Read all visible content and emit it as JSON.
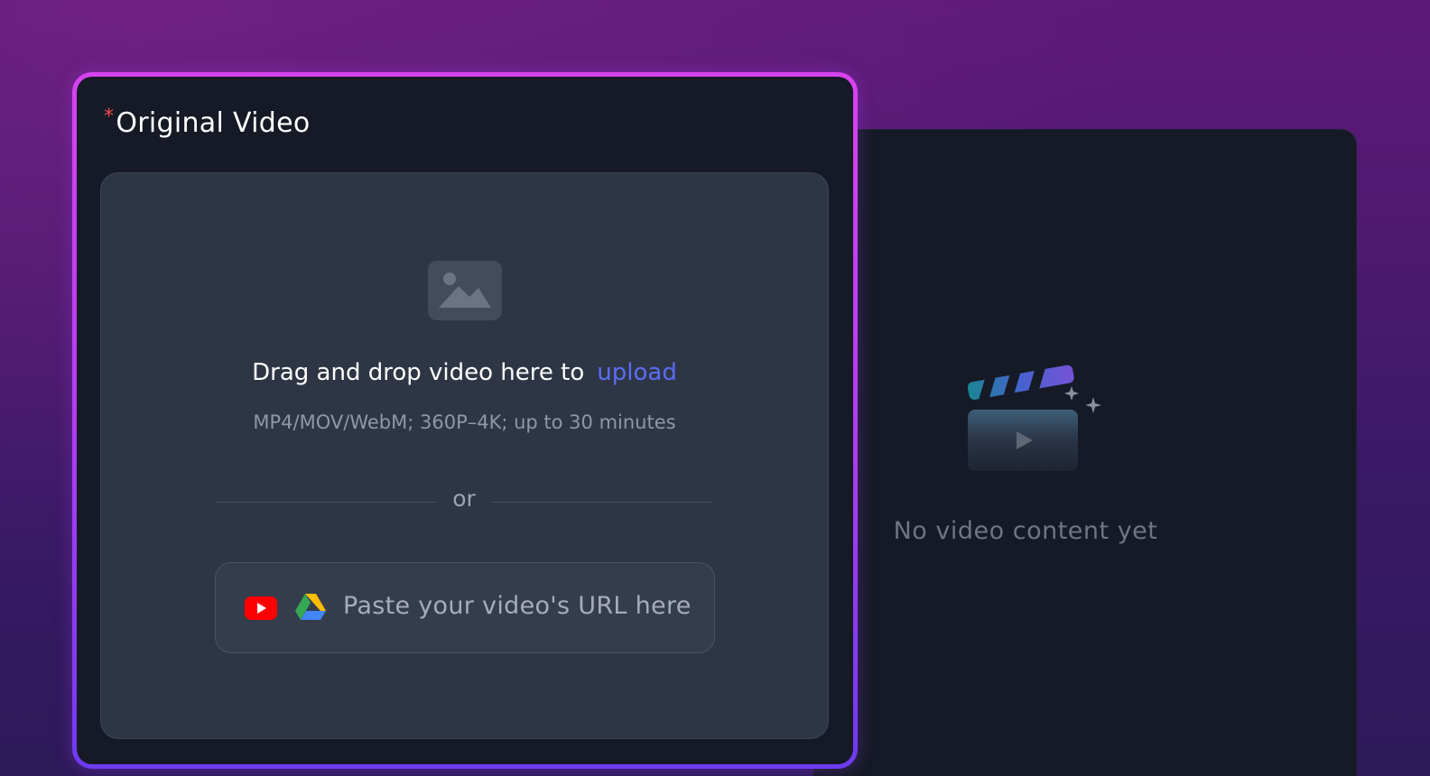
{
  "upload_card": {
    "required_mark": "*",
    "title": "Original Video",
    "drag_text": "Drag and drop video here to",
    "upload_link": "upload",
    "formats": "MP4/MOV/WebM; 360P–4K; up to 30 minutes",
    "divider_text": "or",
    "url_placeholder": "Paste your video's URL here",
    "icons": {
      "image": "image-placeholder-icon",
      "youtube": "youtube-icon",
      "drive": "google-drive-icon"
    }
  },
  "preview": {
    "empty_text": "No video content yet",
    "icon": "clapperboard-icon"
  },
  "colors": {
    "accent_border": "#d743ee",
    "link": "#5b6cf4",
    "required": "#ef4a4a",
    "panel_bg": "#151a26",
    "dropzone_bg": "#2e3645"
  }
}
